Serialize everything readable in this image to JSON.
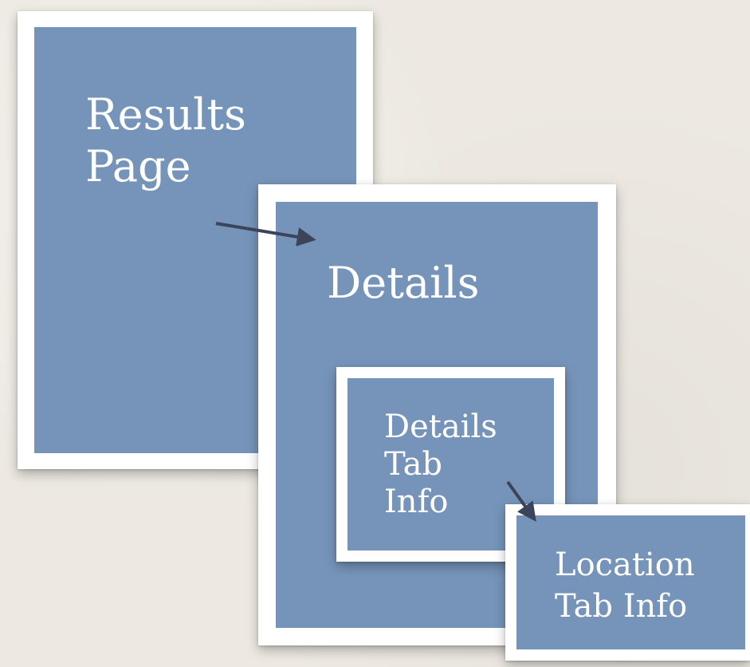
{
  "boxes": {
    "results": {
      "lines": [
        "Results",
        "Page"
      ]
    },
    "details": {
      "lines": [
        "Details"
      ]
    },
    "details_tab": {
      "lines": [
        "Details",
        "Tab",
        "Info"
      ]
    },
    "location_tab": {
      "lines": [
        "Location",
        "Tab Info"
      ]
    }
  },
  "colors": {
    "panel": "#7694ba",
    "frame": "#ffffff",
    "background": "#ede9e2",
    "arrow": "#3b4458"
  }
}
